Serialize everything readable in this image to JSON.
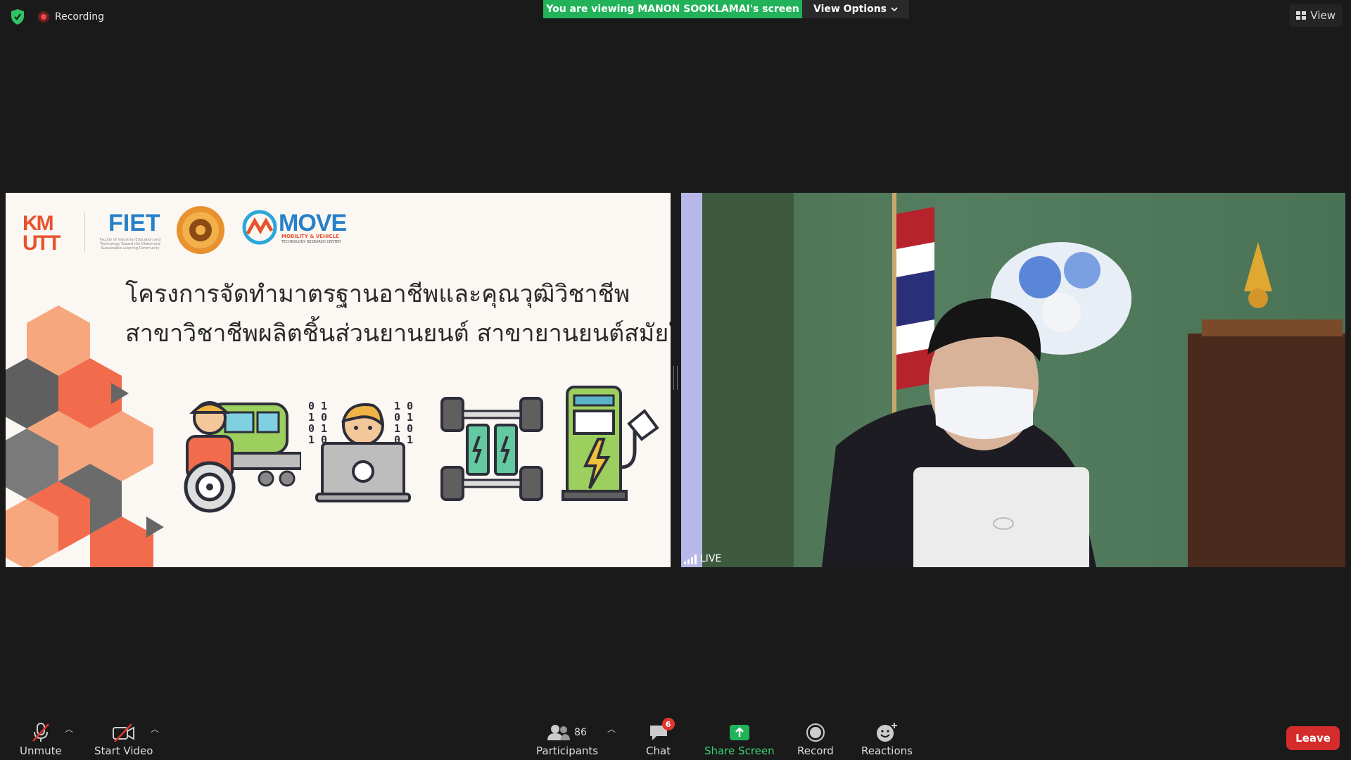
{
  "top": {
    "recording_label": "Recording",
    "banner_text": "You are viewing MANON SOOKLAMAI's screen",
    "view_options_label": "View Options",
    "view_label": "View"
  },
  "shared_slide": {
    "logos": {
      "km_line1": "KM",
      "km_line2": "UTT",
      "fiet": "FIET",
      "fiet_sub": "Faculty of Industrial Education and Technology Toward the Global and Sustainable Learning Community",
      "move": "MOVE",
      "move_sub": "MOBILITY & VEHICLE",
      "move_sub2": "TECHNOLOGY RESEARCH CENTER"
    },
    "title_line1": "โครงการจัดทำมาตรฐานอาชีพและคุณวุฒิวิชาชีพ",
    "title_line2": "สาขาวิชาชีพผลิตชิ้นส่วนยานยนต์ สาขายานยนต์สมัยใหม่",
    "binary_left": [
      "0 1",
      "1 0",
      "0 1",
      "1 0"
    ],
    "binary_right": [
      "1 0",
      "0 1",
      "1 0",
      "0 1"
    ]
  },
  "video": {
    "live_label": "LIVE"
  },
  "toolbar": {
    "unmute": "Unmute",
    "start_video": "Start Video",
    "participants": "Participants",
    "participants_count": "86",
    "chat": "Chat",
    "chat_badge": "6",
    "share_screen": "Share Screen",
    "record": "Record",
    "reactions": "Reactions",
    "leave": "Leave"
  },
  "colors": {
    "share_green": "#22b35a",
    "leave_red": "#d42b2b",
    "background": "#1a1a1a"
  }
}
